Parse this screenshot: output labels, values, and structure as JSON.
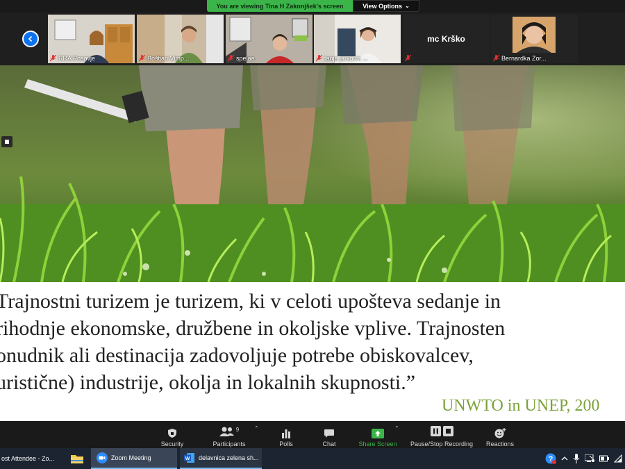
{
  "banner": {
    "viewing_text": "You are viewing Tina H Zakonjšek's screen",
    "view_options_label": "View Options"
  },
  "participants_strip": {
    "tiles": [
      {
        "name": "RRA Posavje",
        "muted": true
      },
      {
        "name": "Boštjan Vimp...",
        "muted": true
      },
      {
        "name": "spelaa",
        "muted": true
      },
      {
        "name": "tanja jarkovic ...",
        "muted": true
      },
      {
        "name": "mc Krško",
        "muted": true,
        "video_off": true
      },
      {
        "name": "Bernardka Zor...",
        "muted": true
      }
    ]
  },
  "shared_slide": {
    "quote_lines": [
      "Trajnostni turizem je turizem, ki v celoti upošteva sedanje in",
      "rihodnje ekonomske, družbene in okoljske vplive. Trajnosten",
      "onudnik ali destinacija zadovoljuje potrebe obiskovalcev,",
      "uristične) industrije, okolja in lokalnih skupnosti.”"
    ],
    "source": "UNWTO in UNEP, 200"
  },
  "toolbar": {
    "security": "Security",
    "participants": "Participants",
    "participants_count": "9",
    "polls": "Polls",
    "chat": "Chat",
    "share_screen": "Share Screen",
    "recording": "Pause/Stop Recording",
    "reactions": "Reactions"
  },
  "taskbar": {
    "tasks": [
      {
        "label": "ost Attendee - Zo..."
      },
      {
        "label": "Zoom Meeting"
      },
      {
        "label": "delavnica zelena sh..."
      }
    ]
  },
  "colors": {
    "share_green": "#3bb54a",
    "zoom_blue": "#0e72ed",
    "source_green": "#7aa23a"
  }
}
